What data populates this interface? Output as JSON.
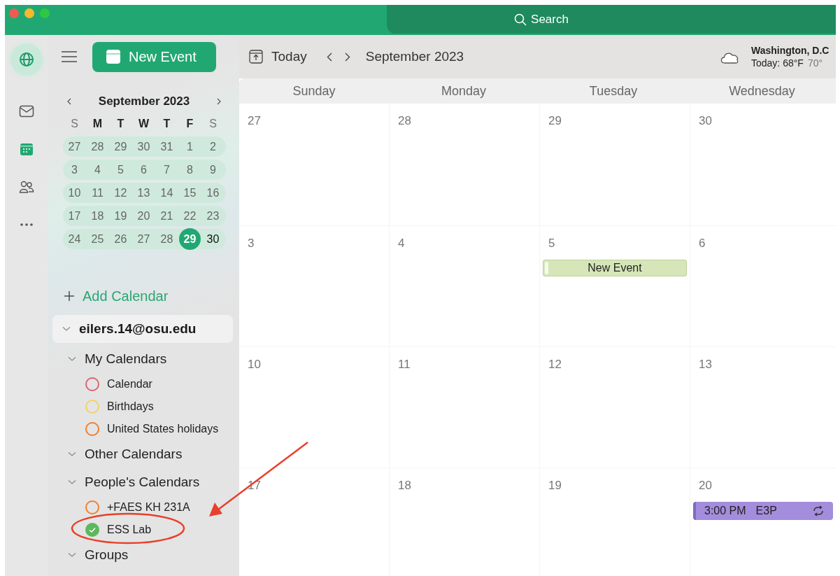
{
  "title_bar": {
    "search": {
      "placeholder": "Search"
    }
  },
  "rail": [
    {
      "kind": "mail",
      "selected": false
    },
    {
      "kind": "calendar",
      "selected": true
    },
    {
      "kind": "people",
      "selected": false
    },
    {
      "kind": "more",
      "selected": false
    }
  ],
  "new_event_button": "New Event",
  "mini_calendar": {
    "title": "September 2023",
    "weekdays": [
      {
        "label": "S",
        "weekend": true
      },
      {
        "label": "M",
        "weekend": false
      },
      {
        "label": "T",
        "weekend": false
      },
      {
        "label": "W",
        "weekend": false
      },
      {
        "label": "T",
        "weekend": false
      },
      {
        "label": "F",
        "weekend": false
      },
      {
        "label": "S",
        "weekend": true
      }
    ],
    "weeks": [
      [
        {
          "day": "27",
          "in_range": true,
          "selected": false
        },
        {
          "day": "28",
          "in_range": true,
          "selected": false
        },
        {
          "day": "29",
          "in_range": true,
          "selected": false
        },
        {
          "day": "30",
          "in_range": true,
          "selected": false
        },
        {
          "day": "31",
          "in_range": true,
          "selected": false
        },
        {
          "day": "1",
          "in_range": true,
          "selected": false
        },
        {
          "day": "2",
          "in_range": true,
          "selected": false
        }
      ],
      [
        {
          "day": "3",
          "in_range": true,
          "selected": false
        },
        {
          "day": "4",
          "in_range": true,
          "selected": false
        },
        {
          "day": "5",
          "in_range": true,
          "selected": false
        },
        {
          "day": "6",
          "in_range": true,
          "selected": false
        },
        {
          "day": "7",
          "in_range": true,
          "selected": false
        },
        {
          "day": "8",
          "in_range": true,
          "selected": false
        },
        {
          "day": "9",
          "in_range": true,
          "selected": false
        }
      ],
      [
        {
          "day": "10",
          "in_range": true,
          "selected": false
        },
        {
          "day": "11",
          "in_range": true,
          "selected": false
        },
        {
          "day": "12",
          "in_range": true,
          "selected": false
        },
        {
          "day": "13",
          "in_range": true,
          "selected": false
        },
        {
          "day": "14",
          "in_range": true,
          "selected": false
        },
        {
          "day": "15",
          "in_range": true,
          "selected": false
        },
        {
          "day": "16",
          "in_range": true,
          "selected": false
        }
      ],
      [
        {
          "day": "17",
          "in_range": true,
          "selected": false
        },
        {
          "day": "18",
          "in_range": true,
          "selected": false
        },
        {
          "day": "19",
          "in_range": true,
          "selected": false
        },
        {
          "day": "20",
          "in_range": true,
          "selected": false
        },
        {
          "day": "21",
          "in_range": true,
          "selected": false
        },
        {
          "day": "22",
          "in_range": true,
          "selected": false
        },
        {
          "day": "23",
          "in_range": true,
          "selected": false
        }
      ],
      [
        {
          "day": "24",
          "in_range": true,
          "selected": false
        },
        {
          "day": "25",
          "in_range": true,
          "selected": false
        },
        {
          "day": "26",
          "in_range": true,
          "selected": false
        },
        {
          "day": "27",
          "in_range": true,
          "selected": false
        },
        {
          "day": "28",
          "in_range": true,
          "selected": false
        },
        {
          "day": "29",
          "in_range": true,
          "selected": true
        },
        {
          "day": "30",
          "in_range": false,
          "selected": false
        }
      ]
    ]
  },
  "add_calendar": "Add Calendar",
  "account": {
    "label": "eilers.14@osu.edu",
    "expanded": true,
    "groups": [
      {
        "label": "My Calendars",
        "expanded": true,
        "calendars": [
          {
            "name": "Calendar",
            "color": "#e06272",
            "checked": false
          },
          {
            "name": "Birthdays",
            "color": "#f2d26a",
            "checked": false
          },
          {
            "name": "United States holidays",
            "color": "#f0802e",
            "checked": false
          }
        ]
      },
      {
        "label": "Other Calendars",
        "expanded": true
      },
      {
        "label": "People's Calendars",
        "expanded": true,
        "calendars": [
          {
            "name": "+FAES KH 231A",
            "color": "#f0802e",
            "checked": false
          },
          {
            "name": "ESS Lab",
            "color": "#5cb85c",
            "checked": true
          }
        ]
      },
      {
        "label": "Groups",
        "expanded": true
      }
    ]
  },
  "toolbar": {
    "today": "Today",
    "period": "September 2023",
    "weather": {
      "location": "Washington, D.C",
      "today": "Today: 68°F",
      "high": "70°"
    }
  },
  "week_header": [
    "Sunday",
    "Monday",
    "Tuesday",
    "Wednesday"
  ],
  "weeks": [
    [
      {
        "day": "27"
      },
      {
        "day": "28"
      },
      {
        "day": "29"
      },
      {
        "day": "30"
      }
    ],
    [
      {
        "day": "3"
      },
      {
        "day": "4"
      },
      {
        "day": "5",
        "events": [
          {
            "kind": "allday",
            "title": "New Event",
            "color": "#d6e6b8"
          }
        ]
      },
      {
        "day": "6"
      }
    ],
    [
      {
        "day": "10"
      },
      {
        "day": "11"
      },
      {
        "day": "12"
      },
      {
        "day": "13"
      }
    ],
    [
      {
        "day": "17"
      },
      {
        "day": "18"
      },
      {
        "day": "19"
      },
      {
        "day": "20",
        "events": [
          {
            "kind": "timed",
            "time": "3:00 PM",
            "title": "E3P",
            "color": "#a48ddc",
            "recurring": true
          }
        ]
      }
    ]
  ]
}
